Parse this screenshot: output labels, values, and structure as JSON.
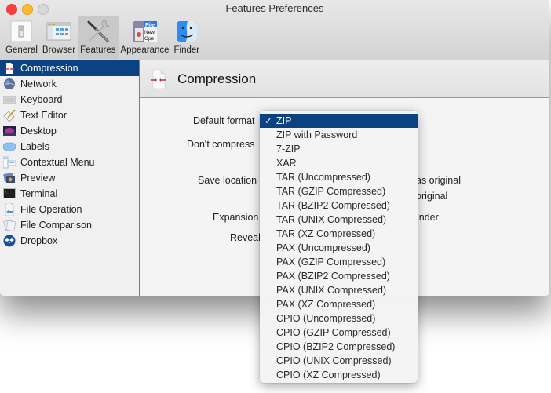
{
  "window": {
    "title": "Features Preferences",
    "traffic_lights": {
      "close": "#fc3d39",
      "minimize": "#fdbb2d",
      "zoom": "#d8d8d8"
    }
  },
  "toolbar": {
    "items": [
      {
        "label": "General",
        "icon": "general-switch-icon",
        "active": false
      },
      {
        "label": "Browser",
        "icon": "browser-window-icon",
        "active": false
      },
      {
        "label": "Features",
        "icon": "tools-icon",
        "active": true
      },
      {
        "label": "Appearance",
        "icon": "appearance-menu-icon",
        "active": false
      },
      {
        "label": "Finder",
        "icon": "finder-icon",
        "active": false
      }
    ]
  },
  "sidebar": {
    "items": [
      {
        "label": "Compression",
        "icon": "compression-icon",
        "selected": true
      },
      {
        "label": "Network",
        "icon": "globe-icon",
        "selected": false
      },
      {
        "label": "Keyboard",
        "icon": "keyboard-icon",
        "selected": false
      },
      {
        "label": "Text Editor",
        "icon": "pencil-icon",
        "selected": false
      },
      {
        "label": "Desktop",
        "icon": "desktop-icon",
        "selected": false
      },
      {
        "label": "Labels",
        "icon": "label-icon",
        "selected": false
      },
      {
        "label": "Contextual Menu",
        "icon": "contextual-menu-icon",
        "selected": false
      },
      {
        "label": "Preview",
        "icon": "preview-icon",
        "selected": false
      },
      {
        "label": "Terminal",
        "icon": "terminal-icon",
        "selected": false
      },
      {
        "label": "File Operation",
        "icon": "file-operation-icon",
        "selected": false
      },
      {
        "label": "File Comparison",
        "icon": "file-comparison-icon",
        "selected": false
      },
      {
        "label": "Dropbox",
        "icon": "dropbox-icon",
        "selected": false
      }
    ]
  },
  "content": {
    "title": "Compression",
    "labels": {
      "default_format": "Default format",
      "dont_compress": "Don't compress",
      "save_location": "Save location",
      "expansion": "Expansion",
      "reveal": "Reveal"
    },
    "partial_texts": {
      "save_same_as_original": "as original",
      "save_original": "original",
      "expansion_finder": "inder"
    }
  },
  "format_menu": {
    "selected": "ZIP",
    "options": [
      "ZIP",
      "ZIP with Password",
      "7-ZIP",
      "XAR",
      "TAR (Uncompressed)",
      "TAR (GZIP Compressed)",
      "TAR (BZIP2 Compressed)",
      "TAR (UNIX Compressed)",
      "TAR (XZ Compressed)",
      "PAX (Uncompressed)",
      "PAX (GZIP Compressed)",
      "PAX (BZIP2 Compressed)",
      "PAX (UNIX Compressed)",
      "PAX (XZ Compressed)",
      "CPIO (Uncompressed)",
      "CPIO (GZIP Compressed)",
      "CPIO (BZIP2 Compressed)",
      "CPIO (UNIX Compressed)",
      "CPIO (XZ Compressed)"
    ],
    "checkmark": "✓",
    "highlight_color": "#0a4282"
  }
}
